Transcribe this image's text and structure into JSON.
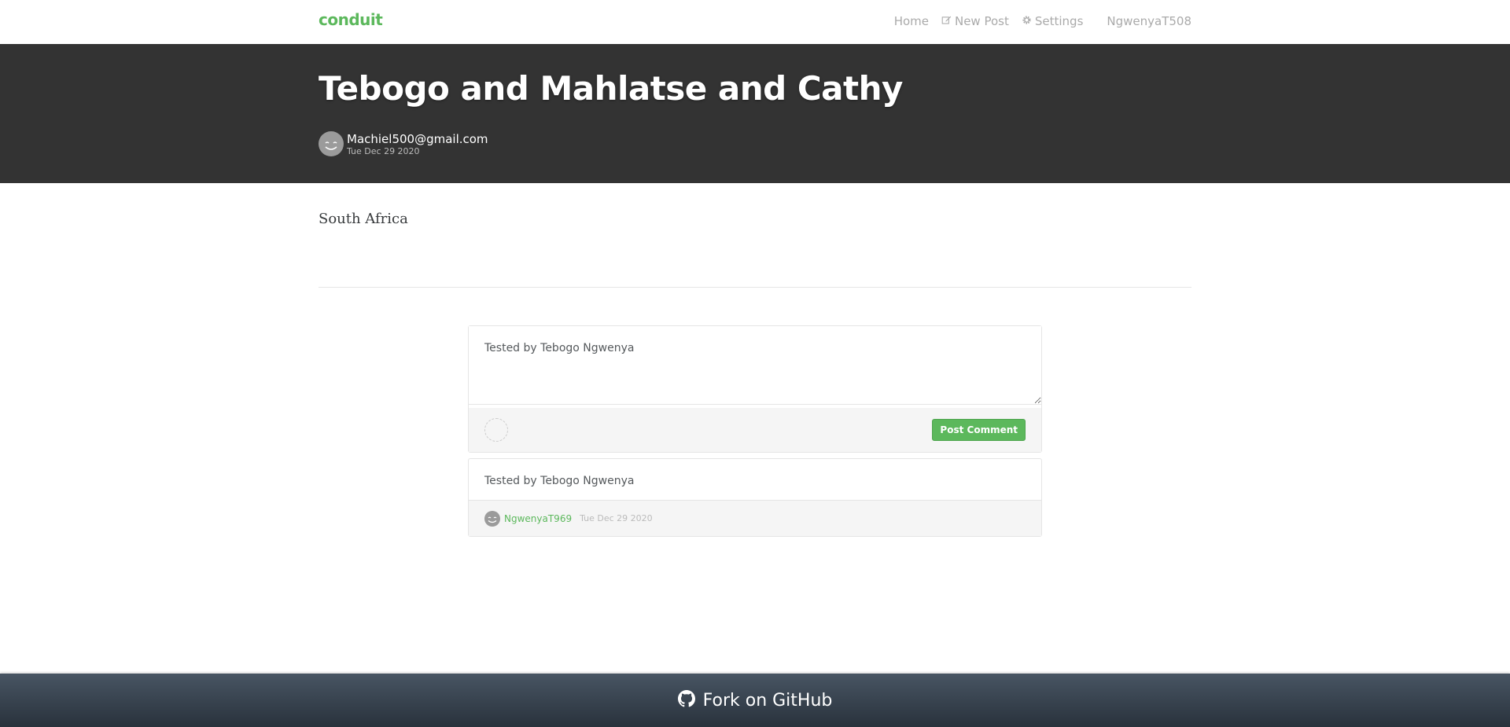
{
  "nav": {
    "brand": "conduit",
    "home": "Home",
    "new_post": "New Post",
    "settings": "Settings",
    "user": "NgwenyaT508"
  },
  "article": {
    "title": "Tebogo and Mahlatse and Cathy",
    "author": "Machiel500@gmail.com",
    "date": "Tue Dec 29 2020",
    "body": "South Africa"
  },
  "comment_form": {
    "text": "Tested by Tebogo Ngwenya",
    "submit_label": "Post Comment"
  },
  "comments": [
    {
      "text": "Tested by Tebogo Ngwenya",
      "author": "NgwenyaT969",
      "date": "Tue Dec 29 2020"
    }
  ],
  "footer": {
    "label": "Fork on GitHub"
  },
  "colors": {
    "brand": "#5cb85c",
    "banner": "#333333"
  }
}
